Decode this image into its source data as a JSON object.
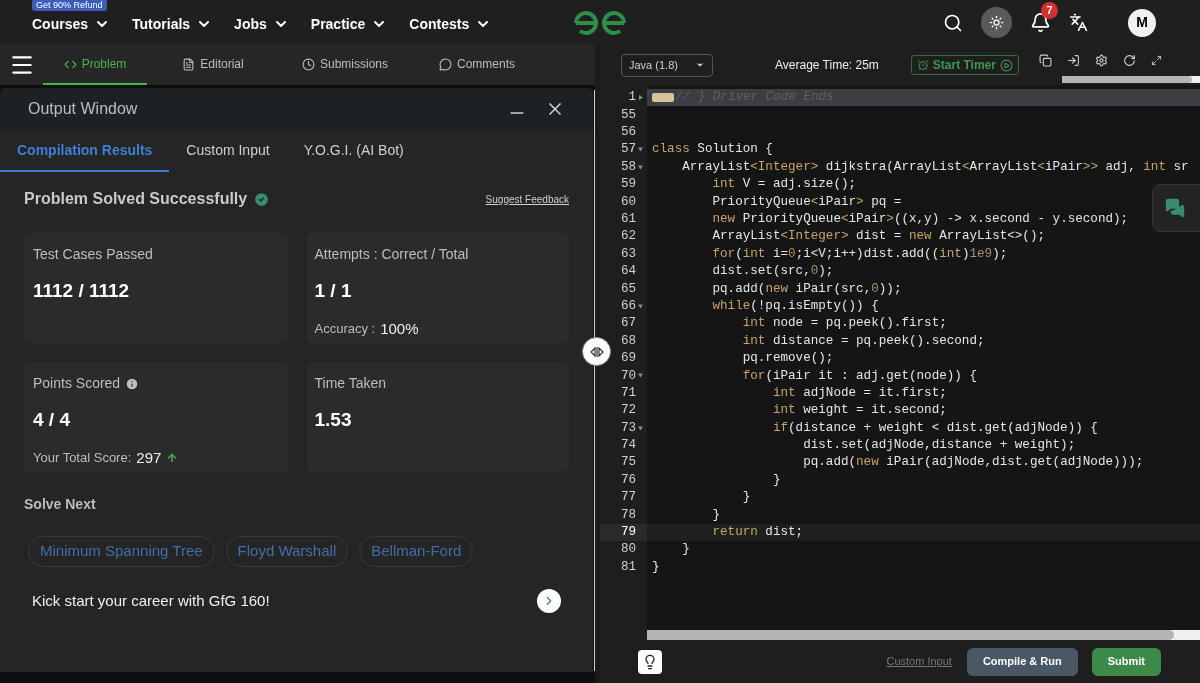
{
  "nav": {
    "items": [
      {
        "label": "Courses",
        "badge": "Get 90% Refund"
      },
      {
        "label": "Tutorials"
      },
      {
        "label": "Jobs"
      },
      {
        "label": "Practice"
      },
      {
        "label": "Contests"
      }
    ],
    "theme_toggle": {
      "on": true
    },
    "notifications": {
      "count": "7"
    },
    "avatar": "M"
  },
  "problem_tabs": [
    {
      "label": "Problem",
      "selected": true
    },
    {
      "label": "Editorial",
      "selected": false
    },
    {
      "label": "Submissions",
      "selected": false
    },
    {
      "label": "Comments",
      "selected": false
    }
  ],
  "output_window": {
    "title": "Output Window",
    "tabs": [
      {
        "label": "Compilation Results",
        "selected": true
      },
      {
        "label": "Custom Input",
        "selected": false
      },
      {
        "label": "Y.O.G.I. (AI Bot)",
        "selected": false
      }
    ],
    "status": "Problem Solved Successfully",
    "feedback_link": "Suggest Feedback",
    "cards": [
      {
        "label": "Test Cases Passed",
        "value": "1112 / 1112",
        "info": false,
        "trend_up": false
      },
      {
        "label": "Attempts : Correct / Total",
        "value": "1 / 1",
        "extra_label": "Accuracy :",
        "extra_value": "100%",
        "info": false,
        "trend_up": false
      },
      {
        "label": "Points Scored",
        "value": "4 / 4",
        "extra_label": "Your Total Score:",
        "extra_value": "297",
        "info": true,
        "trend_up": true
      },
      {
        "label": "Time Taken",
        "value": "1.53",
        "info": false,
        "trend_up": false
      }
    ],
    "solve_next": {
      "title": "Solve Next",
      "chips": [
        "Minimum Spanning Tree",
        "Floyd Warshall",
        "Bellman-Ford"
      ]
    },
    "promo": "Kick start your career with GfG 160!"
  },
  "editor": {
    "language": "Java (1.8)",
    "average_time": "Average Time: 25m",
    "timer_button": "Start Timer",
    "lines": [
      {
        "number": "1",
        "foldable": true,
        "current": false,
        "collapsed": true,
        "tokens": [
          {
            "kind": "comment",
            "text": "// } Driver Code Ends"
          }
        ]
      },
      {
        "number": "55",
        "foldable": false,
        "current": false,
        "collapsed": false
      },
      {
        "number": "56",
        "foldable": false,
        "current": false,
        "collapsed": false
      },
      {
        "number": "57",
        "foldable": true,
        "current": false,
        "collapsed": false,
        "tokens": [
          {
            "kind": "keyword",
            "text": "class"
          },
          {
            "kind": "plain",
            "text": " Solution {"
          }
        ]
      },
      {
        "number": "58",
        "foldable": true,
        "current": false,
        "collapsed": false,
        "tokens": [
          {
            "kind": "plain",
            "text": "    ArrayList"
          },
          {
            "kind": "keyword",
            "text": "<Integer>"
          },
          {
            "kind": "plain",
            "text": " dijkstra(ArrayList"
          },
          {
            "kind": "keyword",
            "text": "<"
          },
          {
            "kind": "plain",
            "text": "ArrayList"
          },
          {
            "kind": "keyword",
            "text": "<"
          },
          {
            "kind": "plain",
            "text": "iPair"
          },
          {
            "kind": "keyword",
            "text": ">>"
          },
          {
            "kind": "plain",
            "text": " adj, "
          },
          {
            "kind": "keyword",
            "text": "int"
          },
          {
            "kind": "plain",
            "text": " sr"
          }
        ]
      },
      {
        "number": "59",
        "foldable": false,
        "current": false,
        "collapsed": false,
        "tokens": [
          {
            "kind": "keyword",
            "text": "        int"
          },
          {
            "kind": "plain",
            "text": " V = adj.size();"
          }
        ]
      },
      {
        "number": "60",
        "foldable": false,
        "current": false,
        "collapsed": false,
        "tokens": [
          {
            "kind": "plain",
            "text": "        PriorityQueue"
          },
          {
            "kind": "keyword",
            "text": "<"
          },
          {
            "kind": "plain",
            "text": "iPair"
          },
          {
            "kind": "keyword",
            "text": ">"
          },
          {
            "kind": "plain",
            "text": " pq ="
          }
        ]
      },
      {
        "number": "61",
        "foldable": false,
        "current": false,
        "collapsed": false,
        "tokens": [
          {
            "kind": "keyword",
            "text": "        new"
          },
          {
            "kind": "plain",
            "text": " PriorityQueue"
          },
          {
            "kind": "keyword",
            "text": "<"
          },
          {
            "kind": "plain",
            "text": "iPair"
          },
          {
            "kind": "keyword",
            "text": ">"
          },
          {
            "kind": "plain",
            "text": "((x,y) -> x.second - y.second);"
          }
        ]
      },
      {
        "number": "62",
        "foldable": false,
        "current": false,
        "collapsed": false,
        "tokens": [
          {
            "kind": "plain",
            "text": "        ArrayList"
          },
          {
            "kind": "keyword",
            "text": "<Integer>"
          },
          {
            "kind": "plain",
            "text": " dist = "
          },
          {
            "kind": "keyword",
            "text": "new"
          },
          {
            "kind": "plain",
            "text": " ArrayList<>();"
          }
        ]
      },
      {
        "number": "63",
        "foldable": false,
        "current": false,
        "collapsed": false,
        "tokens": [
          {
            "kind": "keyword",
            "text": "        for"
          },
          {
            "kind": "plain",
            "text": "("
          },
          {
            "kind": "keyword",
            "text": "int"
          },
          {
            "kind": "plain",
            "text": " i="
          },
          {
            "kind": "number",
            "text": "0"
          },
          {
            "kind": "plain",
            "text": ";i<V;i++)dist.add(("
          },
          {
            "kind": "keyword",
            "text": "int"
          },
          {
            "kind": "plain",
            "text": ")"
          },
          {
            "kind": "number",
            "text": "1e9"
          },
          {
            "kind": "plain",
            "text": ");"
          }
        ]
      },
      {
        "number": "64",
        "foldable": false,
        "current": false,
        "collapsed": false,
        "tokens": [
          {
            "kind": "plain",
            "text": "        dist.set(src,"
          },
          {
            "kind": "number",
            "text": "0"
          },
          {
            "kind": "plain",
            "text": ");"
          }
        ]
      },
      {
        "number": "65",
        "foldable": false,
        "current": false,
        "collapsed": false,
        "tokens": [
          {
            "kind": "plain",
            "text": "        pq.add("
          },
          {
            "kind": "keyword",
            "text": "new"
          },
          {
            "kind": "plain",
            "text": " iPair(src,"
          },
          {
            "kind": "number",
            "text": "0"
          },
          {
            "kind": "plain",
            "text": "));"
          }
        ]
      },
      {
        "number": "66",
        "foldable": true,
        "current": false,
        "collapsed": false,
        "tokens": [
          {
            "kind": "keyword",
            "text": "        while"
          },
          {
            "kind": "plain",
            "text": "(!pq.isEmpty()) {"
          }
        ]
      },
      {
        "number": "67",
        "foldable": false,
        "current": false,
        "collapsed": false,
        "tokens": [
          {
            "kind": "keyword",
            "text": "            int"
          },
          {
            "kind": "plain",
            "text": " node = pq.peek().first;"
          }
        ]
      },
      {
        "number": "68",
        "foldable": false,
        "current": false,
        "collapsed": false,
        "tokens": [
          {
            "kind": "keyword",
            "text": "            int"
          },
          {
            "kind": "plain",
            "text": " distance = pq.peek().second;"
          }
        ]
      },
      {
        "number": "69",
        "foldable": false,
        "current": false,
        "collapsed": false,
        "tokens": [
          {
            "kind": "plain",
            "text": "            pq.remove();"
          }
        ]
      },
      {
        "number": "70",
        "foldable": true,
        "current": false,
        "collapsed": false,
        "tokens": [
          {
            "kind": "keyword",
            "text": "            for"
          },
          {
            "kind": "plain",
            "text": "(iPair it : adj.get(node)) {"
          }
        ]
      },
      {
        "number": "71",
        "foldable": false,
        "current": false,
        "collapsed": false,
        "tokens": [
          {
            "kind": "keyword",
            "text": "                int"
          },
          {
            "kind": "plain",
            "text": " adjNode = it.first;"
          }
        ]
      },
      {
        "number": "72",
        "foldable": false,
        "current": false,
        "collapsed": false,
        "tokens": [
          {
            "kind": "keyword",
            "text": "                int"
          },
          {
            "kind": "plain",
            "text": " weight = it.second;"
          }
        ]
      },
      {
        "number": "73",
        "foldable": true,
        "current": false,
        "collapsed": false,
        "tokens": [
          {
            "kind": "keyword",
            "text": "                if"
          },
          {
            "kind": "plain",
            "text": "(distance + weight < dist.get(adjNode)) {"
          }
        ]
      },
      {
        "number": "74",
        "foldable": false,
        "current": false,
        "collapsed": false,
        "tokens": [
          {
            "kind": "plain",
            "text": "                    dist.set(adjNode,distance + weight);"
          }
        ]
      },
      {
        "number": "75",
        "foldable": false,
        "current": false,
        "collapsed": false,
        "tokens": [
          {
            "kind": "plain",
            "text": "                    pq.add("
          },
          {
            "kind": "keyword",
            "text": "new"
          },
          {
            "kind": "plain",
            "text": " iPair(adjNode,dist.get(adjNode)));"
          }
        ]
      },
      {
        "number": "76",
        "foldable": false,
        "current": false,
        "collapsed": false,
        "tokens": [
          {
            "kind": "plain",
            "text": "                }"
          }
        ]
      },
      {
        "number": "77",
        "foldable": false,
        "current": false,
        "collapsed": false,
        "tokens": [
          {
            "kind": "plain",
            "text": "            }"
          }
        ]
      },
      {
        "number": "78",
        "foldable": false,
        "current": false,
        "collapsed": false,
        "tokens": [
          {
            "kind": "plain",
            "text": "        }"
          }
        ]
      },
      {
        "number": "79",
        "foldable": false,
        "current": true,
        "collapsed": false,
        "tokens": [
          {
            "kind": "keyword",
            "text": "        return"
          },
          {
            "kind": "plain",
            "text": " dist;"
          }
        ]
      },
      {
        "number": "80",
        "foldable": false,
        "current": false,
        "collapsed": false,
        "tokens": [
          {
            "kind": "plain",
            "text": "    }"
          }
        ]
      },
      {
        "number": "81",
        "foldable": false,
        "current": false,
        "collapsed": false,
        "tokens": [
          {
            "kind": "plain",
            "text": "}"
          }
        ]
      }
    ],
    "custom_input_link": "Custom Input",
    "run_button": "Compile & Run",
    "submit_button": "Submit"
  }
}
